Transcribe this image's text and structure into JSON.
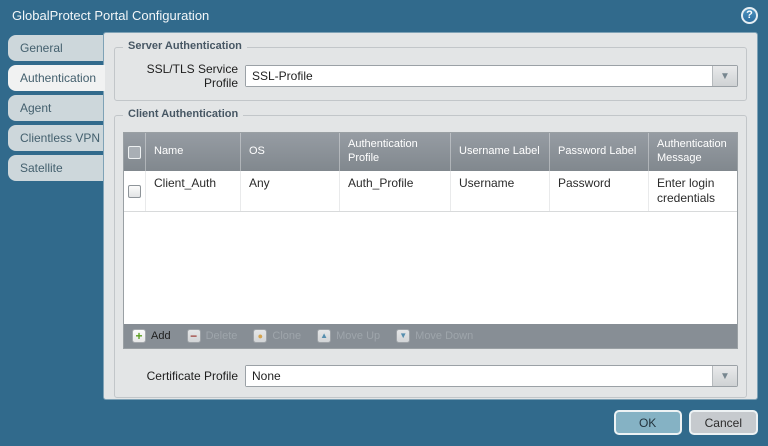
{
  "window": {
    "title": "GlobalProtect Portal Configuration"
  },
  "icons": {
    "help": "?",
    "add": "+",
    "delete": "−",
    "clone": "●",
    "move_up": "▲",
    "move_down": "▼",
    "dropdown": "▼"
  },
  "tabs": [
    {
      "label": "General",
      "active": false
    },
    {
      "label": "Authentication",
      "active": true
    },
    {
      "label": "Agent",
      "active": false
    },
    {
      "label": "Clientless VPN",
      "active": false
    },
    {
      "label": "Satellite",
      "active": false
    }
  ],
  "server_auth": {
    "legend": "Server Authentication",
    "ssl_label": "SSL/TLS Service Profile",
    "ssl_value": "SSL-Profile"
  },
  "client_auth": {
    "legend": "Client Authentication",
    "table": {
      "columns": [
        "Name",
        "OS",
        "Authentication Profile",
        "Username Label",
        "Password Label",
        "Authentication Message"
      ],
      "rows": [
        {
          "name": "Client_Auth",
          "os": "Any",
          "auth_profile": "Auth_Profile",
          "username_label": "Username",
          "password_label": "Password",
          "auth_message": "Enter login credentials",
          "checked": false
        }
      ]
    },
    "toolbar": [
      {
        "label": "Add",
        "enabled": true
      },
      {
        "label": "Delete",
        "enabled": false
      },
      {
        "label": "Clone",
        "enabled": false
      },
      {
        "label": "Move Up",
        "enabled": false
      },
      {
        "label": "Move Down",
        "enabled": false
      }
    ],
    "cert_label": "Certificate Profile",
    "cert_value": "None"
  },
  "footer": {
    "ok": "OK",
    "cancel": "Cancel"
  },
  "colors": {
    "dialog_teal": "#316A8C",
    "panel_gray": "#E3E5E6",
    "header_gray": "#8A9096",
    "ok_blue": "#85B2C4",
    "add_green": "#5A9E1F",
    "delete_red": "#A93A30",
    "clone_yellow": "#E8A93D",
    "move_blue": "#4A8FB5"
  }
}
